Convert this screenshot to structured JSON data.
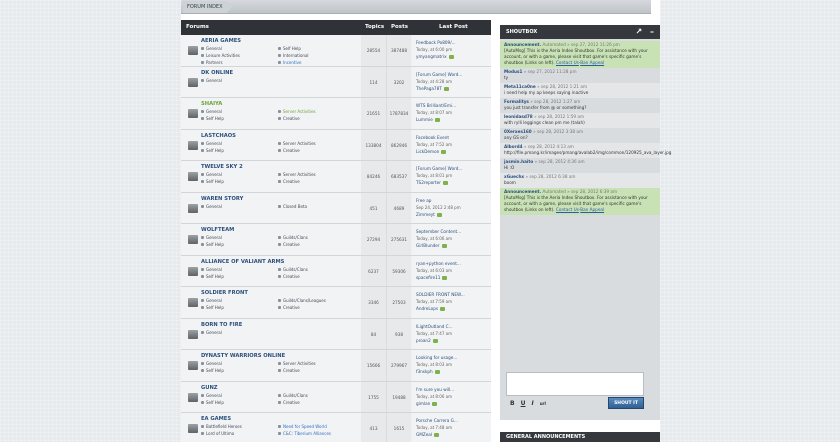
{
  "breadcrumb": {
    "label": "FORUM INDEX"
  },
  "forum_header": {
    "forums": "Forums",
    "topics": "Topics",
    "posts": "Posts",
    "last_post": "Last Post"
  },
  "forums": [
    {
      "title": "AERIA GAMES",
      "subs_left": [
        "General",
        "Leisure Activities",
        "Partners"
      ],
      "subs_right": [
        "Self Help",
        "International",
        "Incentive"
      ],
      "topics": "28554",
      "posts": "387488",
      "last_title": "Feedback Po809/...",
      "last_date": "Today, at 6:00 pm",
      "last_user": "ymyangmatrix"
    },
    {
      "title": "DK ONLINE",
      "subs_left": [
        "General"
      ],
      "subs_right": [],
      "topics": "114",
      "posts": "3202",
      "last_title": "[Forum Game] Word...",
      "last_date": "Today, at 4:28 am",
      "last_user": "ThePaga78T"
    },
    {
      "title": "SHAIYA",
      "subs_left": [
        "General",
        "Self Help"
      ],
      "subs_right": [
        "Server Activities",
        "Creative"
      ],
      "topics": "21651",
      "posts": "1787834",
      "last_title": "WTS Brilliant/Emi...",
      "last_date": "Today, at 8:07 am",
      "last_user": "Lummie"
    },
    {
      "title": "LASTCHAOS",
      "subs_left": [
        "General",
        "Self Help"
      ],
      "subs_right": [
        "Server Activities",
        "Creative"
      ],
      "topics": "133804",
      "posts": "862946",
      "last_title": "Facebook Event",
      "last_date": "Today, at 7:52 am",
      "last_user": "LickDemon"
    },
    {
      "title": "TWELVE SKY 2",
      "subs_left": [
        "General",
        "Self Help"
      ],
      "subs_right": [
        "Server Activities",
        "Creative"
      ],
      "topics": "84246",
      "posts": "683537",
      "last_title": "[Forum Game] Word...",
      "last_date": "Today, at 8:01 pm",
      "last_user": "TS2reporter"
    },
    {
      "title": "WAREN STORY",
      "subs_left": [
        "General"
      ],
      "subs_right": [
        "Closed Beta"
      ],
      "topics": "451",
      "posts": "4689",
      "last_title": "Free ap",
      "last_date": "Sep 24, 2012 2:48 pm",
      "last_user": "Zimmeyt"
    },
    {
      "title": "WOLFTEAM",
      "subs_left": [
        "General",
        "Self Help"
      ],
      "subs_right": [
        "Guilds/Clans",
        "Creative"
      ],
      "topics": "27294",
      "posts": "275631",
      "last_title": "September Content...",
      "last_date": "Today, at 6:06 am",
      "last_user": "GirlBlunder"
    },
    {
      "title": "ALLIANCE OF VALIANT ARMS",
      "subs_left": [
        "General",
        "Self Help"
      ],
      "subs_right": [
        "Guilds/Clans",
        "Creative"
      ],
      "topics": "6237",
      "posts": "59306",
      "last_title": "ryan+python event...",
      "last_date": "Today, at 6:03 am",
      "last_user": "spacefire11"
    },
    {
      "title": "SOLDIER FRONT",
      "subs_left": [
        "General",
        "Self Help"
      ],
      "subs_right": [
        "Guilds/Clans/Leagues",
        "Creative"
      ],
      "topics": "3346",
      "posts": "27503",
      "last_title": "SOLDIER FRONT NEW...",
      "last_date": "Today, at 7:59 am",
      "last_user": "AndreLops"
    },
    {
      "title": "BORN TO FIRE",
      "subs_left": [
        "General"
      ],
      "subs_right": [],
      "topics": "84",
      "posts": "938",
      "last_title": "ILightOutland C...",
      "last_date": "Today, at 7:47 am",
      "last_user": "proan2"
    },
    {
      "title": "DYNASTY WARRIORS ONLINE",
      "subs_left": [
        "General",
        "Self Help"
      ],
      "subs_right": [
        "Server Activities",
        "Creative"
      ],
      "topics": "15666",
      "posts": "279967",
      "last_title": "Looking for usage...",
      "last_date": "Today, at 8:03 am",
      "last_user": "f3nskph"
    },
    {
      "title": "GUNZ",
      "subs_left": [
        "General",
        "Self Help"
      ],
      "subs_right": [
        "Guilds/Clans",
        "Creative"
      ],
      "topics": "1755",
      "posts": "19488",
      "last_title": "I'm sure you will...",
      "last_date": "Today, at 8:06 am",
      "last_user": "gimlan"
    },
    {
      "title": "EA GAMES",
      "subs_left": [
        "Battlefield Heroes",
        "Lord of Ultima"
      ],
      "subs_right": [
        "Need for Speed World",
        "C&C: Tiberium Alliances"
      ],
      "topics": "413",
      "posts": "1615",
      "last_title": "Porsche Carrera G...",
      "last_date": "Today, at 7:48 am",
      "last_user": "GMZeal"
    }
  ],
  "shoutbox": {
    "title": "SHOUTBOX",
    "messages": [
      {
        "user": "Announcement.",
        "meta": "Automated » sep 27, 2012 11:26 pm",
        "text": "[AutoMsg] This is the Aeria Index Shoutbox. For assistance with your account, or with a game, please visit that game's specific game's shoutbox (Links on left).",
        "link1": "Contact Us",
        "link2": "Ban Appeal",
        "auto": true
      },
      {
        "user": "Modus1",
        "meta": "» sep 27, 2012 11:28 pm",
        "text": "ty"
      },
      {
        "user": "Meta11ca0ne",
        "meta": "» sep 28, 2012 1:21 am",
        "text": "i need help my ap keeps saying inactive"
      },
      {
        "user": "Formalitys",
        "meta": "» sep 28, 2012 1:27 am",
        "text": "you just transfer from @ or something?"
      },
      {
        "user": "leonidasd78",
        "meta": "» sep 28, 2012 1:59 am",
        "text": "with rylli leggings clean pm me (talah)"
      },
      {
        "user": "0Xerxes160",
        "meta": "» sep 28, 2012 3:38 am",
        "text": "any GS on?"
      },
      {
        "user": "Albord4",
        "meta": "» sep 28, 2012 4:13 am",
        "text": "http://file.pmang.kr/images/pmang/avalab2/img/common/120925_ava_layer.jpg"
      },
      {
        "user": "jasmin.haito",
        "meta": "» sep 28, 2012 4:36 am",
        "text": "Hi :O"
      },
      {
        "user": "xGuechx",
        "meta": "» sep 28, 2012 6:38 am",
        "text": "boom"
      },
      {
        "user": "Announcement.",
        "meta": "Automated » sep 28, 2012 6:39 am",
        "text": "[AutoMsg] This is the Aeria Index Shoutbox. For assistance with your account, or with a game, please visit that game's specific game's shoutbox (Links on left).",
        "link1": "Contact Us",
        "link2": "Ban Appeal",
        "auto": true
      }
    ],
    "tools": [
      "B",
      "U",
      "I",
      "url"
    ],
    "button": "SHOUT IT"
  },
  "general_announcements": "GENERAL ANNOUNCEMENTS"
}
